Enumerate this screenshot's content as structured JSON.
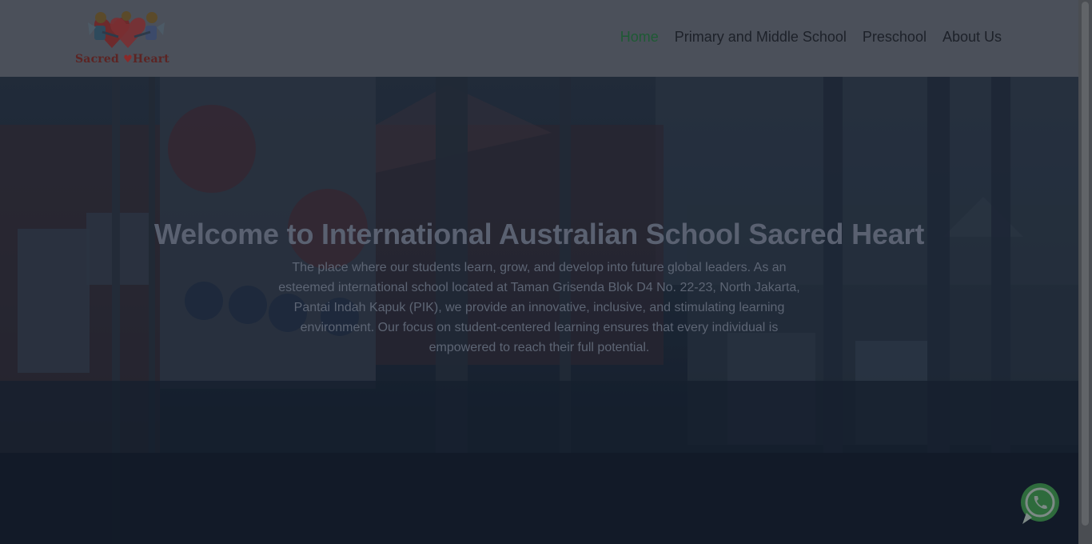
{
  "brand": {
    "logo_text_left": "Sacred",
    "logo_text_right": "Heart"
  },
  "nav": {
    "items": [
      {
        "label": "Home",
        "active": true
      },
      {
        "label": "Primary and Middle School",
        "active": false
      },
      {
        "label": "Preschool",
        "active": false
      },
      {
        "label": "About Us",
        "active": false
      }
    ]
  },
  "hero": {
    "title": "Welcome to International Australian School Sacred Heart",
    "description": "The place where our students learn, grow, and develop into future global leaders. As an esteemed international school located at Taman Grisenda Blok D4 No. 22-23, North Jakarta, Pantai Indah Kapuk (PIK), we provide an innovative, inclusive, and stimulating learning environment. Our focus on student-centered learning ensures that every individual is empowered to reach their full potential."
  },
  "floating": {
    "whatsapp_icon": "whatsapp-icon"
  },
  "colors": {
    "nav_active": "#1e5a34",
    "header_bg": "#4b505a",
    "whatsapp": "#2e6b3c"
  }
}
